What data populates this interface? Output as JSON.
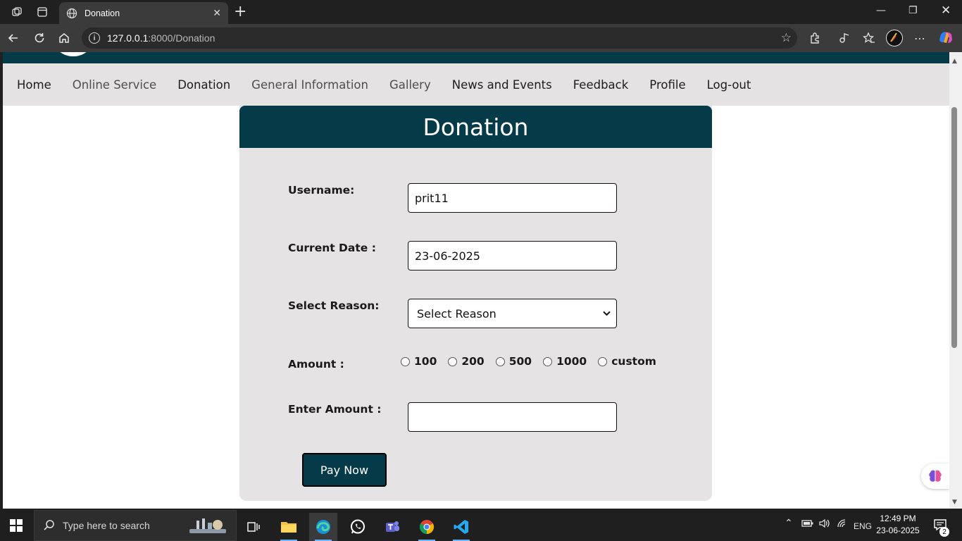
{
  "browser": {
    "tab": {
      "title": "Donation"
    },
    "url": {
      "host": "127.0.0.1",
      "path": ":8000/Donation"
    }
  },
  "site": {
    "nav": [
      {
        "label": "Home"
      },
      {
        "label": "Online Service"
      },
      {
        "label": "Donation"
      },
      {
        "label": "General Information"
      },
      {
        "label": "Gallery"
      },
      {
        "label": "News and Events"
      },
      {
        "label": "Feedback"
      },
      {
        "label": "Profile"
      },
      {
        "label": "Log-out"
      }
    ],
    "colors": {
      "primary": "#053a48",
      "nav_bg": "#e4e2e2",
      "card_bg": "#e5e3e4"
    }
  },
  "form": {
    "title": "Donation",
    "username": {
      "label": "Username:",
      "value": "prit11"
    },
    "date": {
      "label": "Current Date :",
      "value": "23-06-2025"
    },
    "reason": {
      "label": "Select Reason:",
      "selected": "Select Reason"
    },
    "amount": {
      "label": "Amount :",
      "options": [
        "100",
        "200",
        "500",
        "1000",
        "custom"
      ]
    },
    "enter_amount": {
      "label": "Enter Amount :",
      "value": ""
    },
    "pay_label": "Pay Now"
  },
  "taskbar": {
    "search_placeholder": "Type here to search",
    "language": "ENG",
    "time": "12:49 PM",
    "date": "23-06-2025",
    "notification_count": "2"
  }
}
